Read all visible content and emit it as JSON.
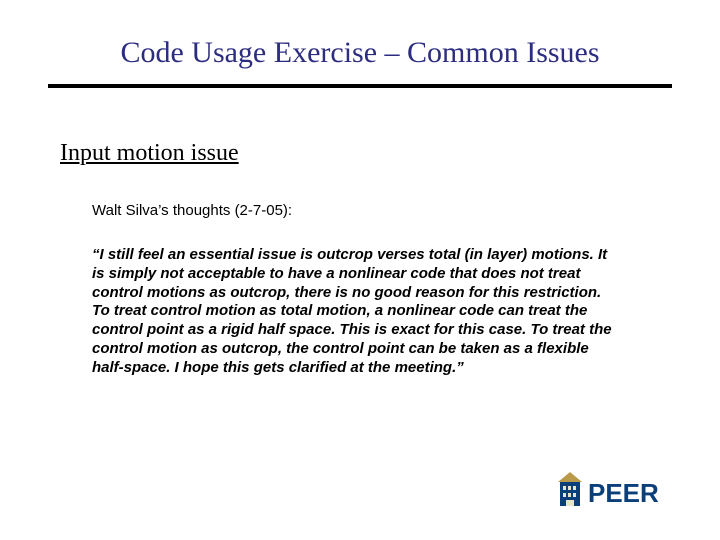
{
  "title": "Code Usage Exercise – Common Issues",
  "subtitle": "Input motion issue",
  "lead": "Walt Silva’s thoughts (2-7-05):",
  "quote": "“I still feel an essential issue is outcrop verses total (in layer) motions. It is simply not acceptable to have a nonlinear code that does not treat control motions as outcrop, there is no good reason for this restriction. To treat control motion as total motion, a nonlinear code can treat the control point as a rigid half space. This is exact for this case. To treat the control motion as outcrop, the control point can be taken as a flexible half-space. I hope this gets clarified at the meeting.”",
  "logo": {
    "text": "PEER",
    "colors": {
      "building": "#0b3f7a",
      "roof": "#b99a4a",
      "text": "#0b3f7a"
    }
  }
}
